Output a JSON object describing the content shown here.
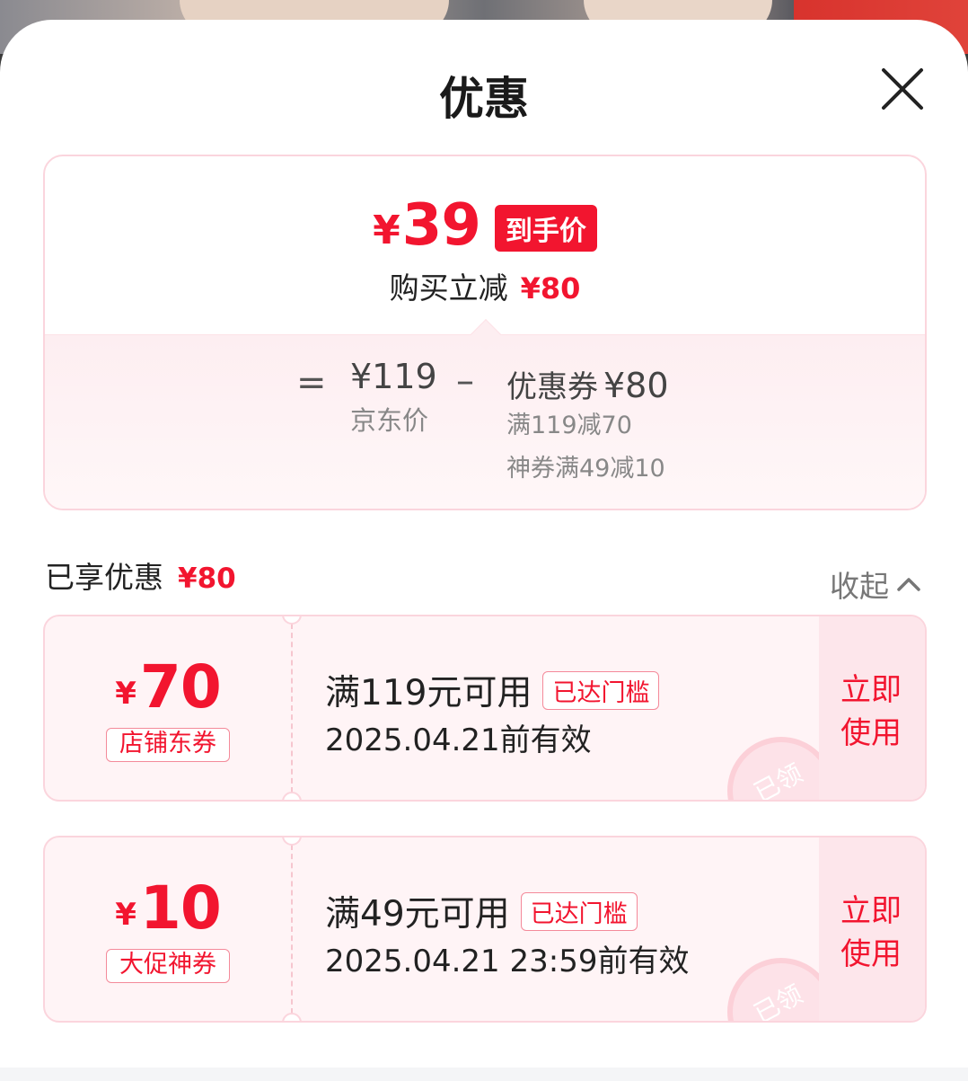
{
  "sheet": {
    "title": "优惠"
  },
  "price_summary": {
    "final_currency": "¥",
    "final_price": "39",
    "final_tag": "到手价",
    "instant_label": "购买立减",
    "instant_amount": "¥80",
    "equals": "=",
    "jd_price": "¥119",
    "jd_label": "京东价",
    "minus": "–",
    "coupon_label": "优惠券",
    "coupon_amount": "¥80",
    "coupon_lines": [
      "满119减70",
      "神券满49减10"
    ]
  },
  "enjoyed": {
    "label": "已享优惠",
    "amount": "¥80",
    "collapse_label": "收起"
  },
  "coupons": [
    {
      "currency": "¥",
      "amount": "70",
      "type": "店铺东券",
      "condition": "满119元可用",
      "badge": "已达门槛",
      "validity": "2025.04.21前有效",
      "action": "立即使用",
      "stamp": "已领"
    },
    {
      "currency": "¥",
      "amount": "10",
      "type": "大促神券",
      "condition": "满49元可用",
      "badge": "已达门槛",
      "validity": "2025.04.21 23:59前有效",
      "action": "立即使用",
      "stamp": "已领"
    }
  ],
  "colors": {
    "accent": "#f2152f",
    "card_border": "#fbd5dd",
    "coupon_bg": "#fff4f6"
  }
}
